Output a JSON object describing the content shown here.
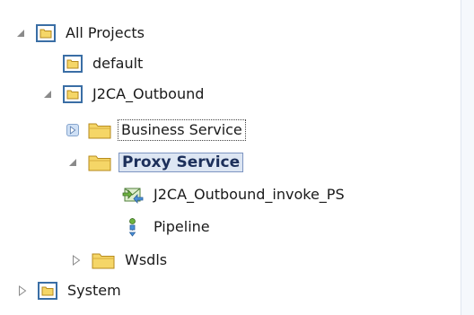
{
  "tree": {
    "nodes": [
      {
        "label": "All Projects",
        "toggle": "expanded",
        "icon": "project-folder-icon"
      },
      {
        "label": "default",
        "toggle": "none",
        "icon": "project-folder-icon"
      },
      {
        "label": "J2CA_Outbound",
        "toggle": "expanded",
        "icon": "project-folder-icon"
      },
      {
        "label": "Business Service",
        "toggle": "collapsed-hover",
        "icon": "folder-icon"
      },
      {
        "label": "Proxy Service",
        "toggle": "expanded",
        "icon": "folder-icon",
        "selected": true
      },
      {
        "label": "J2CA_Outbound_invoke_PS",
        "toggle": "none",
        "icon": "proxy-service-icon"
      },
      {
        "label": "Pipeline",
        "toggle": "none",
        "icon": "pipeline-icon"
      },
      {
        "label": "Wsdls",
        "toggle": "collapsed",
        "icon": "folder-icon"
      },
      {
        "label": "System",
        "toggle": "collapsed",
        "icon": "project-folder-icon"
      }
    ]
  },
  "colors": {
    "selection_background": "#dde6f3",
    "selection_border": "#7d95c1",
    "folder_yellow": "#f5d667",
    "project_folder_border": "#3a6ea5"
  }
}
